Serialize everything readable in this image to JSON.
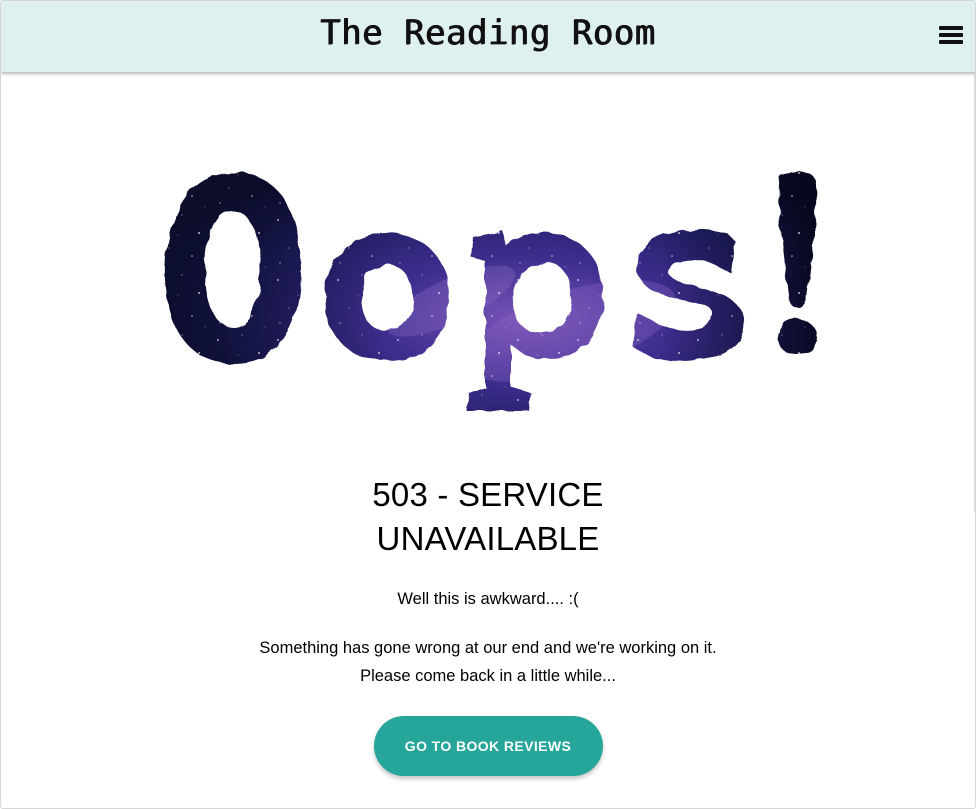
{
  "header": {
    "title": "The Reading Room",
    "menu_icon": "hamburger-menu-icon",
    "background": "#dff0f0"
  },
  "hero": {
    "text": "Oops!",
    "fill_style": "galaxy",
    "colors": [
      "#0b0f2e",
      "#1d1e5e",
      "#3d2f8f",
      "#6a4aa8"
    ]
  },
  "error": {
    "title": "503 - SERVICE UNAVAILABLE",
    "subtitle": "Well this is awkward.... :(",
    "message_line1": "Something has gone wrong at our end and we're working on it.",
    "message_line2": "Please come back in a little while...",
    "button_label": "GO TO BOOK REVIEWS"
  },
  "theme": {
    "accent": "#26a69a"
  }
}
